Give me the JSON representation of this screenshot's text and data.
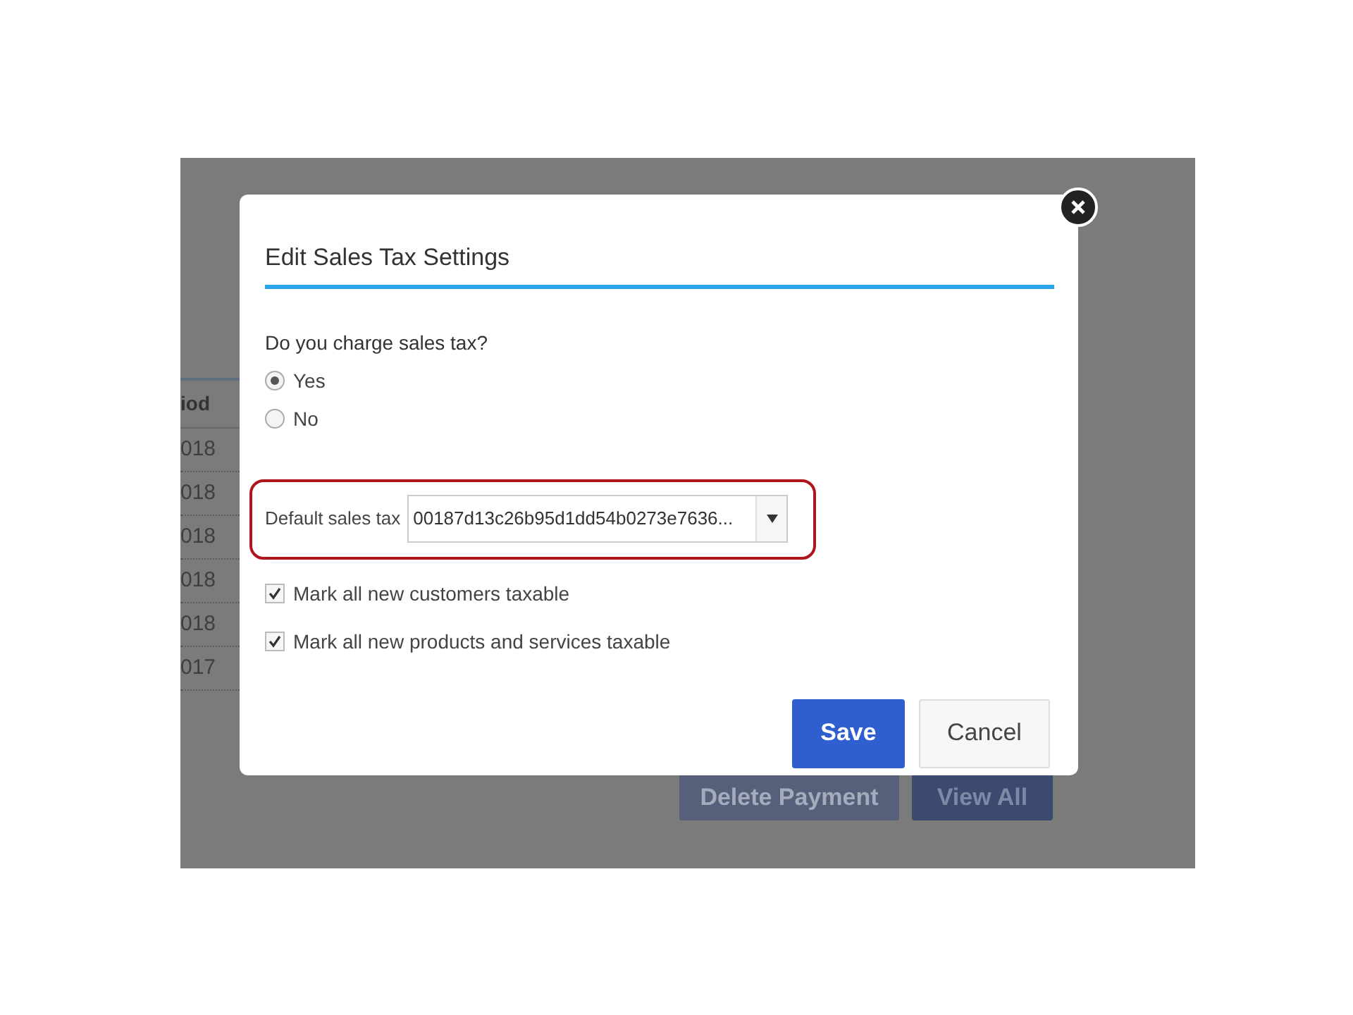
{
  "background": {
    "table": {
      "column_header": "iod",
      "rows": [
        "018",
        "018",
        "018",
        "018",
        "018",
        "017"
      ]
    },
    "buttons": [
      {
        "label": "Delete Payment",
        "kind": "secondary"
      },
      {
        "label": "View All",
        "kind": "primary"
      }
    ]
  },
  "dialog": {
    "title": "Edit Sales Tax Settings",
    "question": "Do you charge sales tax?",
    "options": [
      {
        "label": "Yes",
        "selected": true
      },
      {
        "label": "No",
        "selected": false
      }
    ],
    "default_tax": {
      "label": "Default sales tax",
      "value": "00187d13c26b95d1dd54b0273e7636..."
    },
    "checkboxes": [
      {
        "label": "Mark all new customers taxable",
        "checked": true
      },
      {
        "label": "Mark all new products and services taxable",
        "checked": true
      }
    ],
    "buttons": [
      {
        "label": "Save",
        "kind": "primary"
      },
      {
        "label": "Cancel",
        "kind": "secondary"
      }
    ]
  }
}
